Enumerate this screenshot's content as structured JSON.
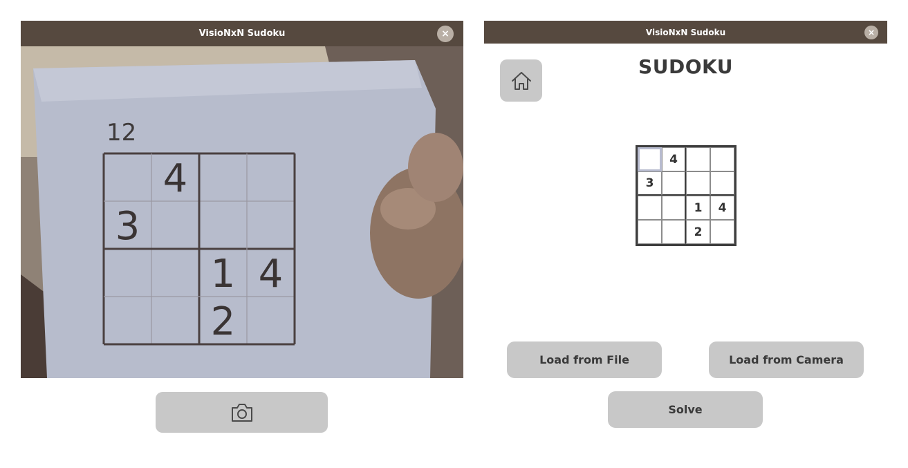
{
  "camera_window": {
    "title": "VisioNxN Sudoku",
    "close_glyph": "×",
    "capture_icon": "camera-icon",
    "paper": {
      "label": "12",
      "digits": [
        {
          "row": 0,
          "col": 1,
          "value": "4"
        },
        {
          "row": 1,
          "col": 0,
          "value": "3"
        },
        {
          "row": 2,
          "col": 2,
          "value": "1"
        },
        {
          "row": 2,
          "col": 3,
          "value": "4"
        },
        {
          "row": 3,
          "col": 2,
          "value": "2"
        }
      ]
    }
  },
  "app_window": {
    "title": "VisioNxN Sudoku",
    "close_glyph": "×",
    "home_icon": "home-icon",
    "heading": "SUDOKU",
    "grid": [
      [
        "",
        "4",
        "",
        ""
      ],
      [
        "3",
        "",
        "",
        ""
      ],
      [
        "",
        "",
        "1",
        "4"
      ],
      [
        "",
        "",
        "2",
        ""
      ]
    ],
    "selected_cell": [
      0,
      0
    ],
    "buttons": {
      "load_file": "Load from File",
      "load_camera": "Load from Camera",
      "solve": "Solve"
    }
  },
  "colors": {
    "titlebar": "#56493f",
    "button": "#c8c8c8",
    "text": "#3a3a3a"
  }
}
